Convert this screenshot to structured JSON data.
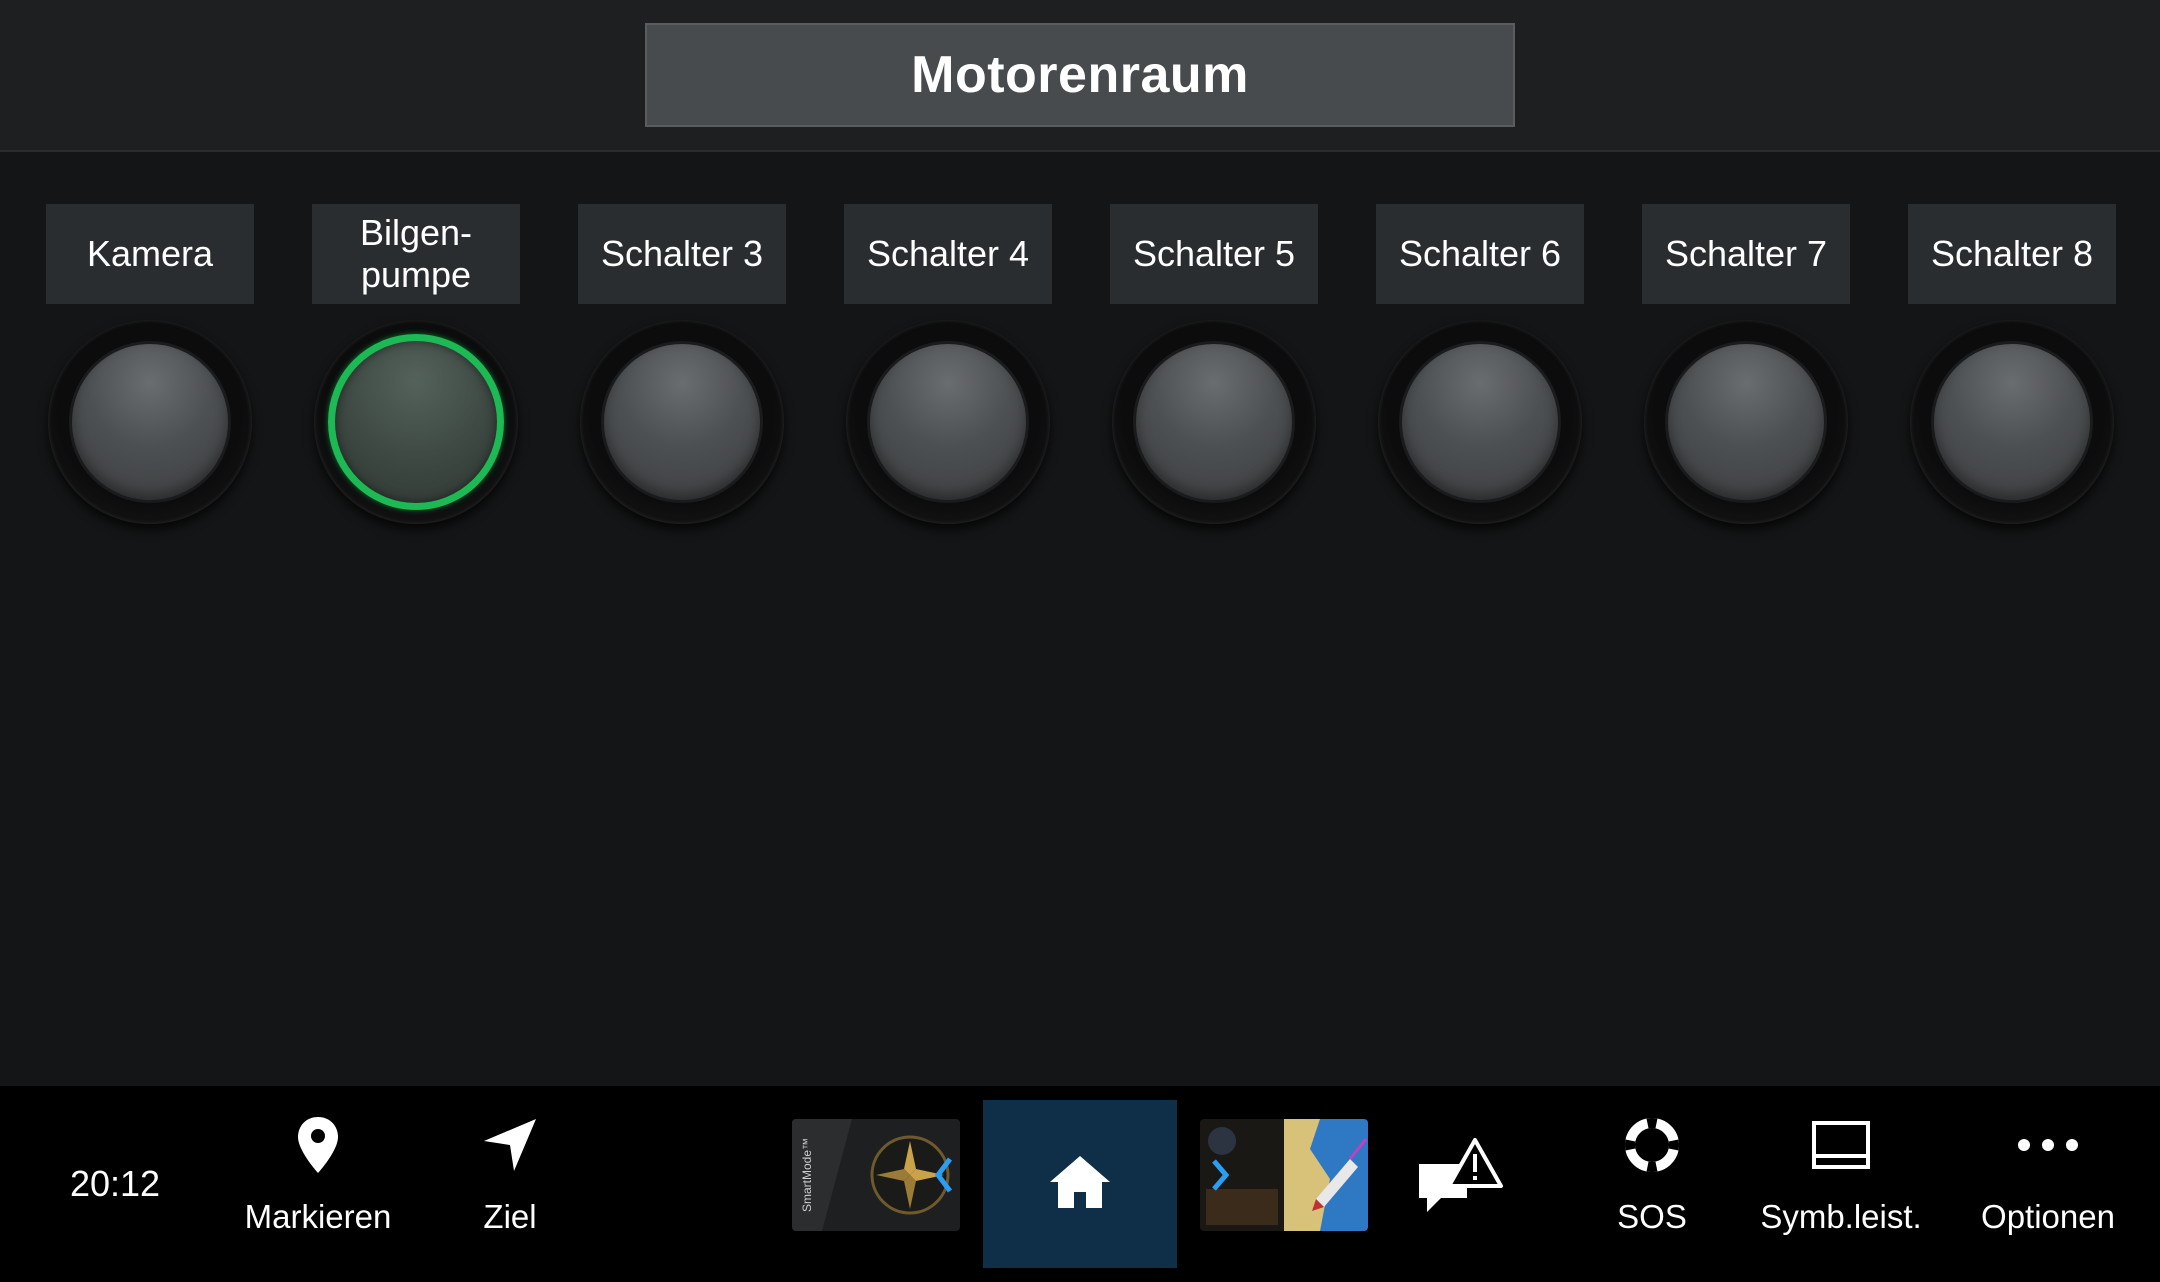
{
  "header": {
    "title": "Motorenraum"
  },
  "switches": [
    {
      "label": "Kamera",
      "on": false
    },
    {
      "label": "Bilgen-\npumpe",
      "on": true
    },
    {
      "label": "Schalter 3",
      "on": false
    },
    {
      "label": "Schalter 4",
      "on": false
    },
    {
      "label": "Schalter 5",
      "on": false
    },
    {
      "label": "Schalter 6",
      "on": false
    },
    {
      "label": "Schalter 7",
      "on": false
    },
    {
      "label": "Schalter 8",
      "on": false
    }
  ],
  "bottombar": {
    "time": "20:12",
    "mark_label": "Markieren",
    "goto_label": "Ziel",
    "smartmode_text": "SmartMode™",
    "sos_label": "SOS",
    "toolbar_label": "Symb.leist.",
    "options_label": "Optionen"
  },
  "icons": {
    "mark": "map-pin-icon",
    "goto": "navigation-arrow-icon",
    "smartmode": "smartmode-compass-icon",
    "home": "home-icon",
    "chart_app": "chart-app-icon",
    "alerts": "alert-message-icon",
    "sos": "lifebuoy-icon",
    "toolbar": "toolbar-icon",
    "options": "more-dots-icon"
  },
  "colors": {
    "switch_on_ring": "#1db954",
    "home_active_bg": "#0f2f48"
  }
}
